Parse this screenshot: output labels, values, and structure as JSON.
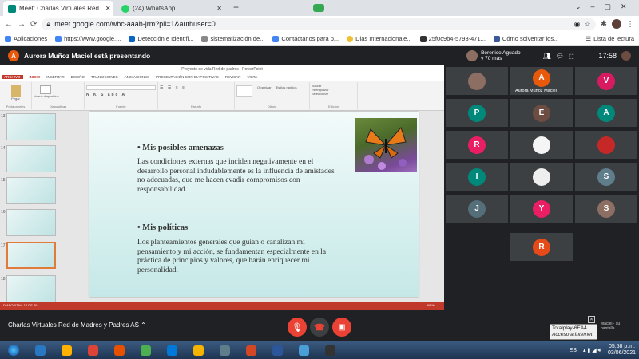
{
  "tabs": [
    {
      "title": "Meet: Charlas Virtuales Red",
      "favicon_color": "#00897b"
    },
    {
      "title": "(24) WhatsApp",
      "favicon_color": "#25d366"
    }
  ],
  "address": {
    "url": "meet.google.com/wbc-aaab-jrm?pli=1&authuser=0"
  },
  "bookmarks": [
    {
      "label": "Aplicaciones",
      "color": "#4285f4"
    },
    {
      "label": "https://www.google....",
      "color": "#4285f4"
    },
    {
      "label": "Detección e Identifi...",
      "color": "#0a66c2"
    },
    {
      "label": "sistematización de...",
      "color": "#888888"
    },
    {
      "label": "Contáctanos para p...",
      "color": "#4285f4"
    },
    {
      "label": "Dias Internacionale...",
      "color": "#f0c030"
    },
    {
      "label": "25f0c9b4-5793-471...",
      "color": "#333333"
    },
    {
      "label": "Cómo solventar los...",
      "color": "#3b5998"
    }
  ],
  "reading_list": "Lista de lectura",
  "meet": {
    "presenting_initial": "A",
    "presenting_text": "Aurora Muñoz Maciel está presentando",
    "host_name": "Berenice Aguado",
    "host_more": "y 70 más",
    "time": "17:58",
    "meeting_name": "Charlas Virtuales Red de Madres y Padres AS",
    "featured_name": "Aurora Muñoz Maciel"
  },
  "ppt": {
    "window_title": "Proyecto de vida Red de padres - PowerPoint",
    "tabs": [
      "ARCHIVO",
      "INICIO",
      "INSERTAR",
      "DISEÑO",
      "TRANSICIONES",
      "ANIMACIONES",
      "PRESENTACIÓN CON DIAPOSITIVAS",
      "REVISAR",
      "VISTA"
    ],
    "groups": [
      "Portapapeles",
      "Diapositivas",
      "Fuente",
      "Párrafo",
      "Dibujo",
      "Edición"
    ],
    "group_buttons": {
      "paste": "Pegar",
      "new_slide": "Nueva diapositiva",
      "arrange": "Organizar",
      "quick_styles": "Estilos rápidos",
      "find": "Buscar",
      "replace": "Reemplazar",
      "select": "Seleccionar"
    },
    "thumb_numbers": [
      "13",
      "14",
      "15",
      "16",
      "17",
      "18"
    ],
    "status": "DIAPOSITIVA 17 DE 20",
    "zoom": "69 %",
    "slide": {
      "heading1": "• Mis posibles amenazas",
      "body1": "Las condiciones externas que inciden negativamente en el desarrollo personal indudablemente es la influencia de amistades no adecuadas, que me hacen evadir compromisos con responsabilidad.",
      "heading2": "• Mis políticas",
      "body2": "Los planteamientos generales que guían o canalizan mi pensamiento y mi acción, se fundamentan especialmente en la práctica de principios y valores, que harán enriquecer mi personalidad."
    }
  },
  "participants": [
    {
      "initial": "",
      "color": "#8d6e63"
    },
    {
      "initial": "A",
      "color": "#e8590c"
    },
    {
      "initial": "V",
      "color": "#d81b60"
    },
    {
      "initial": "P",
      "color": "#00897b"
    },
    {
      "initial": "E",
      "color": "#6d4c41"
    },
    {
      "initial": "A",
      "color": "#00897b"
    },
    {
      "initial": "R",
      "color": "#e91e63"
    },
    {
      "initial": "",
      "color": "#f5f5f5"
    },
    {
      "initial": "",
      "color": "#c62828"
    },
    {
      "initial": "I",
      "color": "#00897b"
    },
    {
      "initial": "",
      "color": "#eeeeee"
    },
    {
      "initial": "S",
      "color": "#607d8b"
    },
    {
      "initial": "J",
      "color": "#546e7a"
    },
    {
      "initial": "Y",
      "color": "#e91e63"
    },
    {
      "initial": "S",
      "color": "#8d6e63"
    },
    {
      "initial": "R",
      "color": "#e64a19"
    }
  ],
  "popup": {
    "title": "Totalplay-6EA4",
    "subtitle": "Acceso a Internet"
  },
  "right_notice": "Maciel · su pantalla",
  "taskbar": {
    "lang": "ES",
    "time": "05:58 p.m.",
    "date": "03/06/2021",
    "apps": [
      "#2b78c2",
      "#ffb300",
      "#db4437",
      "#e65100",
      "#4caf50",
      "#0078d7",
      "#f4b400",
      "#607d8b",
      "#d24726",
      "#2b579a",
      "#4a9fd8",
      "#333333"
    ]
  },
  "colors": {
    "accent_red": "#ea4335",
    "ppt_red": "#c0392b"
  }
}
